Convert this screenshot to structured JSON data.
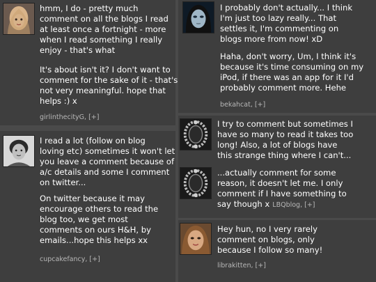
{
  "comments": [
    {
      "author": "girlinthecityG",
      "author_suffix": ", [+]",
      "messages": [
        [
          "hmm, I do - pretty much",
          "comment on all the blogs I read",
          "at least once a fortnight - more",
          "when I read something I really",
          "enjoy - that's what"
        ],
        [
          "It's about isn't it? I don't want to",
          "comment for the sake of it - that's",
          "not very meaningful. hope that",
          "helps :) x"
        ]
      ]
    },
    {
      "author": "bekahcat",
      "author_suffix": ", [+]",
      "messages": [
        [
          "I probably don't actually... I think",
          "I'm just too lazy really... That",
          "settles it, I'm commenting on",
          "blogs more from now! xD"
        ],
        [
          "Haha, don't worry, Um, I think it's",
          "because it's time consuming on my",
          "iPod, if there was an app for it I'd",
          "probably comment more. Hehe"
        ]
      ]
    },
    {
      "author": "cupcakefancy",
      "author_suffix": ", [+]",
      "messages": [
        [
          "I read a lot (follow on blog",
          "loving etc) sometimes it won't let",
          "you leave a comment because of",
          "a/c details and some I comment",
          "on twitter..."
        ],
        [
          "On twitter because it may",
          "encourage others to read the",
          "blog too, we get most",
          "comments on ours H&H, by",
          "emails...hope this helps xx"
        ]
      ]
    },
    {
      "author": "LBQblog",
      "author_suffix": ", [+]",
      "messages": [
        [
          "I try to comment but sometimes I",
          "have so many to read it takes too",
          "long! Also, a lot of blogs have",
          "this strange thing where I can't..."
        ],
        [
          "...actually comment for some",
          "reason, it doesn't let me. I only",
          "comment if I have something to",
          "say though x"
        ]
      ]
    },
    {
      "author": "librakitten",
      "author_suffix": ", [+]",
      "messages": [
        [
          "Hey hun, no I very rarely",
          "comment on blogs, only",
          "because I follow so many!"
        ]
      ]
    }
  ],
  "colors": {
    "background": "#4a4a4a",
    "card": "#3e3e3e",
    "text": "#ffffff",
    "meta": "#b8b8b8"
  },
  "avatars": [
    "blonde-woman-avatar",
    "dark-goth-avatar",
    "vintage-portrait-avatar",
    "ornate-frame-avatar",
    "ornate-frame-avatar",
    "brunette-woman-avatar"
  ]
}
